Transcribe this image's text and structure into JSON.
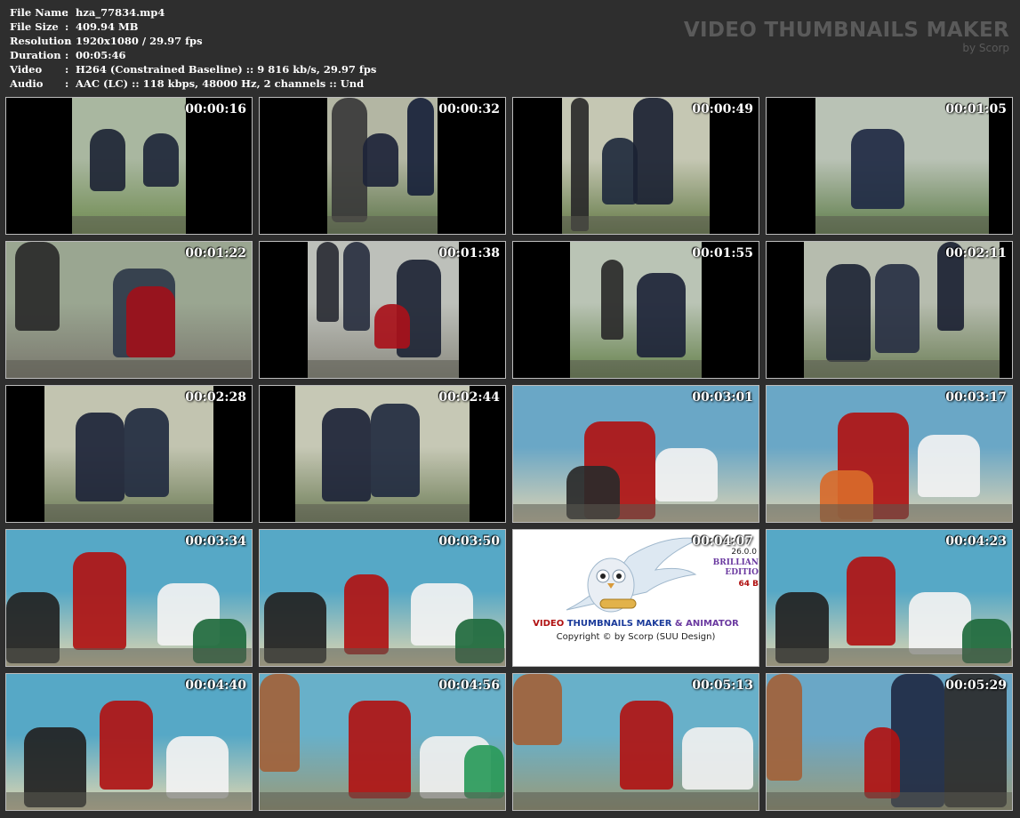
{
  "meta": {
    "rows": [
      {
        "key": "File Name",
        "sep": ":",
        "value": "hza_77834.mp4"
      },
      {
        "key": "File Size",
        "sep": ":",
        "value": "409.94 MB"
      },
      {
        "key": "Resolution",
        "sep": ":",
        "value": "1920x1080 / 29.97 fps"
      },
      {
        "key": "Duration",
        "sep": ":",
        "value": "00:05:46"
      },
      {
        "key": "Video",
        "sep": ":",
        "value": "H264 (Constrained Baseline) :: 9 816 kb/s, 29.97 fps"
      },
      {
        "key": "Audio",
        "sep": ":",
        "value": "AAC (LC) :: 118 kbps, 48000 Hz, 2 channels :: Und"
      }
    ]
  },
  "brand": {
    "title": "VIDEO THUMBNAILS MAKER",
    "sub": "by Scorp"
  },
  "logo": {
    "title_part1": "VIDEO ",
    "title_part2": "THUMBNAILS MAKER",
    "title_part3": " & ANIMATOR",
    "copyright": "Copyright © by Scorp (SUU Design)",
    "version": "26.0.0",
    "edition_line1": "BRILLIAN",
    "edition_line2": "EDITIO",
    "bits": "64 B",
    "color_red": "#b01010",
    "color_blue": "#1a3a9a",
    "color_purple": "#6b3aa0"
  },
  "thumbnails": [
    {
      "time": "00:00:16"
    },
    {
      "time": "00:00:32"
    },
    {
      "time": "00:00:49"
    },
    {
      "time": "00:01:05"
    },
    {
      "time": "00:01:22"
    },
    {
      "time": "00:01:38"
    },
    {
      "time": "00:01:55"
    },
    {
      "time": "00:02:11"
    },
    {
      "time": "00:02:28"
    },
    {
      "time": "00:02:44"
    },
    {
      "time": "00:03:01"
    },
    {
      "time": "00:03:17"
    },
    {
      "time": "00:03:34"
    },
    {
      "time": "00:03:50"
    },
    {
      "time": "00:04:07"
    },
    {
      "time": "00:04:23"
    },
    {
      "time": "00:04:40"
    },
    {
      "time": "00:04:56"
    },
    {
      "time": "00:05:13"
    },
    {
      "time": "00:05:29"
    }
  ]
}
